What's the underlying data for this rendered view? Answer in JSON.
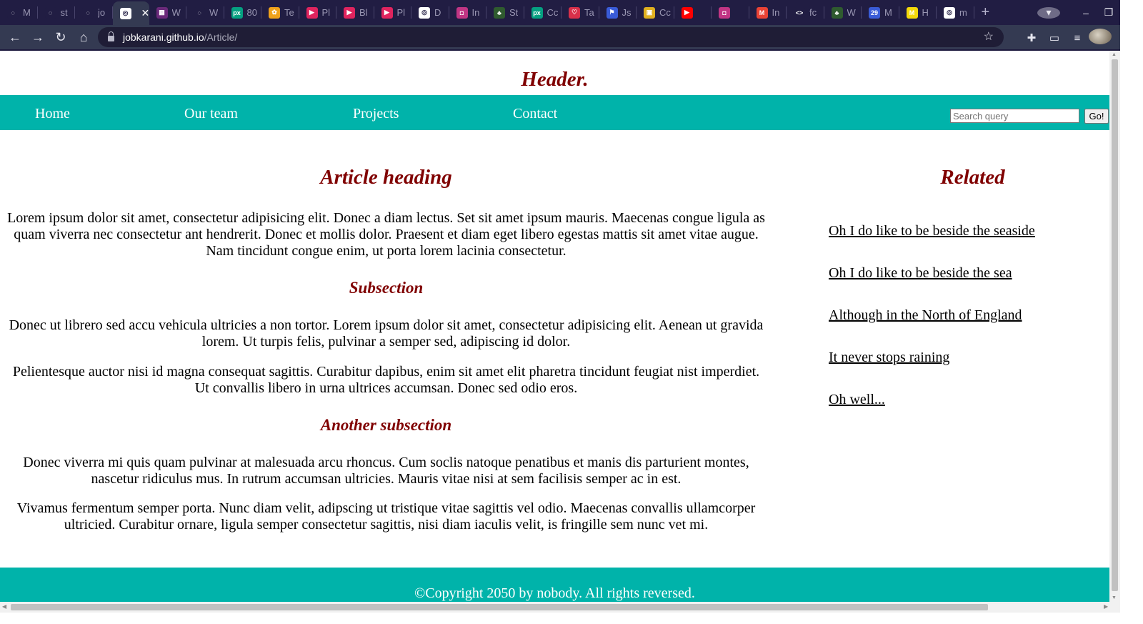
{
  "browser": {
    "tabs": [
      {
        "title": "M",
        "color": "#211d43",
        "glyph": "◌"
      },
      {
        "title": "st",
        "color": "#211d43",
        "glyph": "◌"
      },
      {
        "title": "jo",
        "color": "#211d43",
        "glyph": "◌"
      },
      {
        "title": "",
        "color": "#ffffff",
        "glyph": "◎",
        "active": true
      },
      {
        "title": "W",
        "color": "#6b2a7a",
        "glyph": "▦"
      },
      {
        "title": "W",
        "color": "#211d43",
        "glyph": "◌"
      },
      {
        "title": "80",
        "color": "#05a081",
        "glyph": "px"
      },
      {
        "title": "Te",
        "color": "#f0a21b",
        "glyph": "✿"
      },
      {
        "title": "Pl",
        "color": "#e0245e",
        "glyph": "▶"
      },
      {
        "title": "Bl",
        "color": "#e0245e",
        "glyph": "▶"
      },
      {
        "title": "Pl",
        "color": "#e0245e",
        "glyph": "▶"
      },
      {
        "title": "D",
        "color": "#ffffff",
        "glyph": "◎"
      },
      {
        "title": "In",
        "color": "#c13584",
        "glyph": "◘"
      },
      {
        "title": "St",
        "color": "#2f5b2f",
        "glyph": "♣"
      },
      {
        "title": "Cc",
        "color": "#05a081",
        "glyph": "px"
      },
      {
        "title": "Ta",
        "color": "#d9304a",
        "glyph": "♡"
      },
      {
        "title": "Js",
        "color": "#3a5cd8",
        "glyph": "⚑"
      },
      {
        "title": "Cc",
        "color": "#e0b020",
        "glyph": "▣"
      },
      {
        "title": "",
        "color": "#ff0000",
        "glyph": "▶"
      },
      {
        "title": "",
        "color": "#c13584",
        "glyph": "◘"
      },
      {
        "title": "In",
        "color": "#ea4335",
        "glyph": "M"
      },
      {
        "title": "fc",
        "color": "#211d43",
        "glyph": "<>"
      },
      {
        "title": "W",
        "color": "#2f5b2f",
        "glyph": "♣"
      },
      {
        "title": "M",
        "color": "#3a5cd8",
        "glyph": "29"
      },
      {
        "title": "H",
        "color": "#f5d90a",
        "glyph": "M"
      },
      {
        "title": "m",
        "color": "#ffffff",
        "glyph": "◎"
      }
    ],
    "url_host": "jobkarani.github.io",
    "url_path": "/Article/"
  },
  "site": {
    "header_title": "Header.",
    "nav": [
      "Home",
      "Our team",
      "Projects",
      "Contact"
    ],
    "search_placeholder": "Search query",
    "search_button": "Go!"
  },
  "article": {
    "heading": "Article heading",
    "p1": "Lorem ipsum dolor sit amet, consectetur adipisicing elit. Donec a diam lectus. Set sit amet ipsum mauris. Maecenas congue ligula as quam viverra nec consectetur ant hendrerit. Donec et mollis dolor. Praesent et diam eget libero egestas mattis sit amet vitae augue. Nam tincidunt congue enim, ut porta lorem lacinia consectetur.",
    "sub1": "Subsection",
    "p2": "Donec ut librero sed accu vehicula ultricies a non tortor. Lorem ipsum dolor sit amet, consectetur adipisicing elit. Aenean ut gravida lorem. Ut turpis felis, pulvinar a semper sed, adipiscing id dolor.",
    "p3": "Pelientesque auctor nisi id magna consequat sagittis. Curabitur dapibus, enim sit amet elit pharetra tincidunt feugiat nist imperdiet. Ut convallis libero in urna ultrices accumsan. Donec sed odio eros.",
    "sub2": "Another subsection",
    "p4": "Donec viverra mi quis quam pulvinar at malesuada arcu rhoncus. Cum soclis natoque penatibus et manis dis parturient montes, nascetur ridiculus mus. In rutrum accumsan ultricies. Mauris vitae nisi at sem facilisis semper ac in est.",
    "p5": "Vivamus fermentum semper porta. Nunc diam velit, adipscing ut tristique vitae sagittis vel odio. Maecenas convallis ullamcorper ultricied. Curabitur ornare, ligula semper consectetur sagittis, nisi diam iaculis velit, is fringille sem nunc vet mi."
  },
  "related": {
    "heading": "Related",
    "links": [
      "Oh I do like to be beside the seaside",
      "Oh I do like to be beside the sea",
      "Although in the North of England",
      "It never stops raining",
      "Oh well..."
    ]
  },
  "footer": {
    "text": "©Copyright 2050 by nobody. All rights reversed."
  },
  "colors": {
    "accent": "#00b3aa",
    "heading": "#800000",
    "chrome": "#211d43"
  }
}
